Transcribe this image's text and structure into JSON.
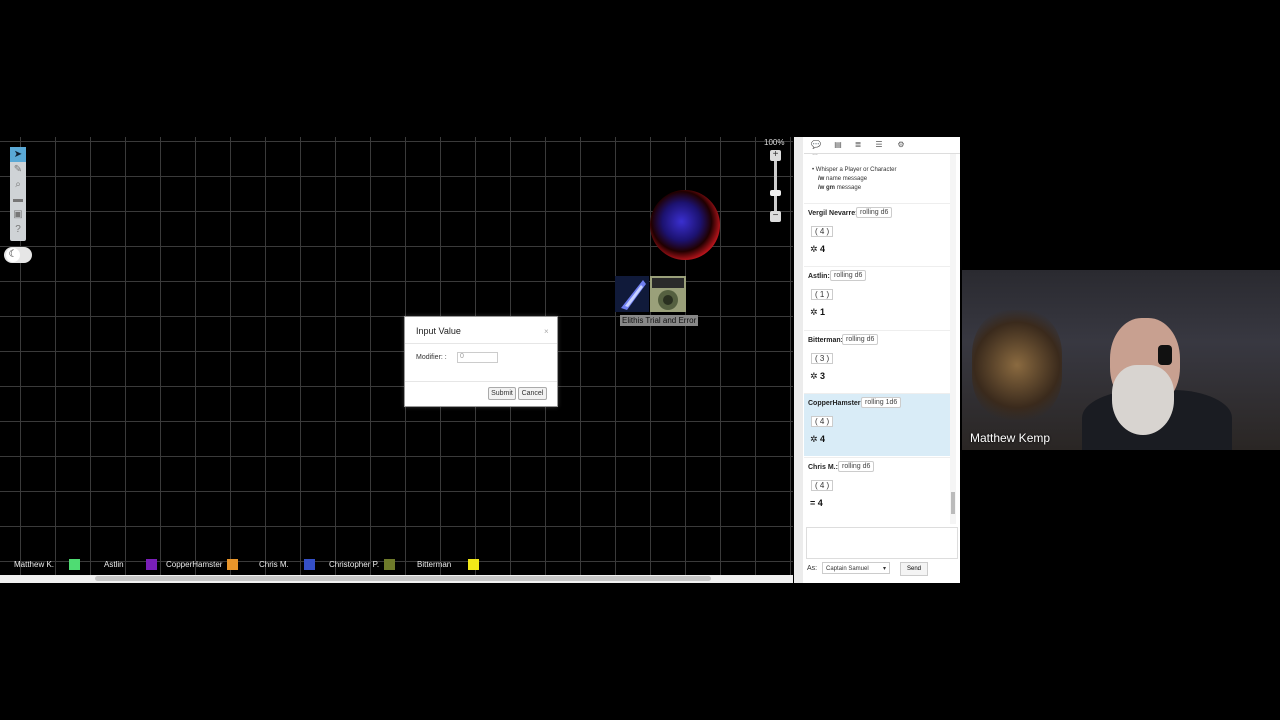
{
  "zoom": {
    "label": "100%"
  },
  "token": {
    "label": "Elithis Trial and Error"
  },
  "dialog": {
    "title": "Input Value",
    "close": "×",
    "modifier_label": "Modifier: :",
    "modifier_value": "0",
    "submit_label": "Submit",
    "cancel_label": "Cancel"
  },
  "players": [
    {
      "name": "Matthew K.",
      "color": "#4fdc73"
    },
    {
      "name": "Astlin",
      "color": "#7a1fb8"
    },
    {
      "name": "CopperHamster",
      "color": "#e8952a"
    },
    {
      "name": "Chris M.",
      "color": "#3550c8"
    },
    {
      "name": "Christopher P.",
      "color": "#6e7a2a"
    },
    {
      "name": "Bitterman",
      "color": "#f1e818"
    }
  ],
  "chat": {
    "help_partial": "…",
    "help_title": "Whisper a Player or Character",
    "help_line1_cmd": "/w",
    "help_line1_rest": "name message",
    "help_line2_cmd": "/w",
    "help_line2_gm": "gm",
    "help_line2_rest": "message",
    "messages": [
      {
        "who": "Vergil Nevarre:",
        "cmd": "rolling d6",
        "roll": "( 4 )",
        "result": "4"
      },
      {
        "who": "Astlin:",
        "cmd": "rolling d6",
        "roll": "( 1 )",
        "result": "1"
      },
      {
        "who": "Bitterman:",
        "cmd": "rolling d6",
        "roll": "( 3 )",
        "result": "3"
      },
      {
        "who": "CopperHamster:",
        "cmd": "rolling 1d6",
        "roll": "( 4 )",
        "result": "4"
      },
      {
        "who": "Chris M.:",
        "cmd": "rolling d6",
        "roll": "( 4 )",
        "result": "= 4"
      }
    ],
    "as_label": "As:",
    "as_value": "Captain Samuel",
    "send_label": "Send"
  },
  "webcam": {
    "name": "Matthew Kemp"
  }
}
